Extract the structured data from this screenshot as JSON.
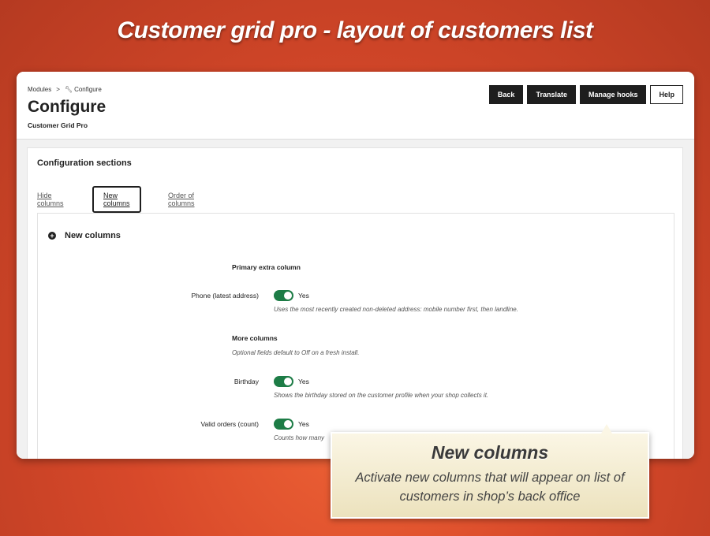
{
  "banner": {
    "title": "Customer grid pro - layout of customers list"
  },
  "breadcrumb": {
    "parent": "Modules",
    "separator": ">",
    "current": "Configure"
  },
  "header": {
    "title": "Configure",
    "subtitle": "Customer Grid Pro",
    "buttons": {
      "back": "Back",
      "translate": "Translate",
      "manage_hooks": "Manage hooks",
      "help": "Help"
    }
  },
  "config": {
    "title": "Configuration sections",
    "tabs": [
      "Hide columns",
      "New columns",
      "Order of columns"
    ],
    "active_tab": "New columns"
  },
  "section": {
    "title": "New columns",
    "primary": {
      "heading": "Primary extra column",
      "field_label": "Phone (latest address)",
      "toggle_label": "Yes",
      "toggle_on": true,
      "help": "Uses the most recently created non-deleted address: mobile number first, then landline."
    },
    "more": {
      "heading": "More columns",
      "help": "Optional fields default to Off on a fresh install."
    },
    "birthday": {
      "field_label": "Birthday",
      "toggle_label": "Yes",
      "toggle_on": true,
      "help": "Shows the birthday stored on the customer profile when your shop collects it."
    },
    "valid_orders": {
      "field_label": "Valid orders (count)",
      "toggle_label": "Yes",
      "toggle_on": true,
      "help": "Counts how many"
    }
  },
  "callout": {
    "title": "New columns",
    "text": "Activate new columns that will appear on list of customers in shop’s back office"
  },
  "colors": {
    "accent_toggle": "#1d7c46",
    "dark_button": "#1e1e1e",
    "background": "#d8492a"
  },
  "icons": {
    "breadcrumb": "wrench-icon",
    "section": "plus-circle-icon"
  }
}
